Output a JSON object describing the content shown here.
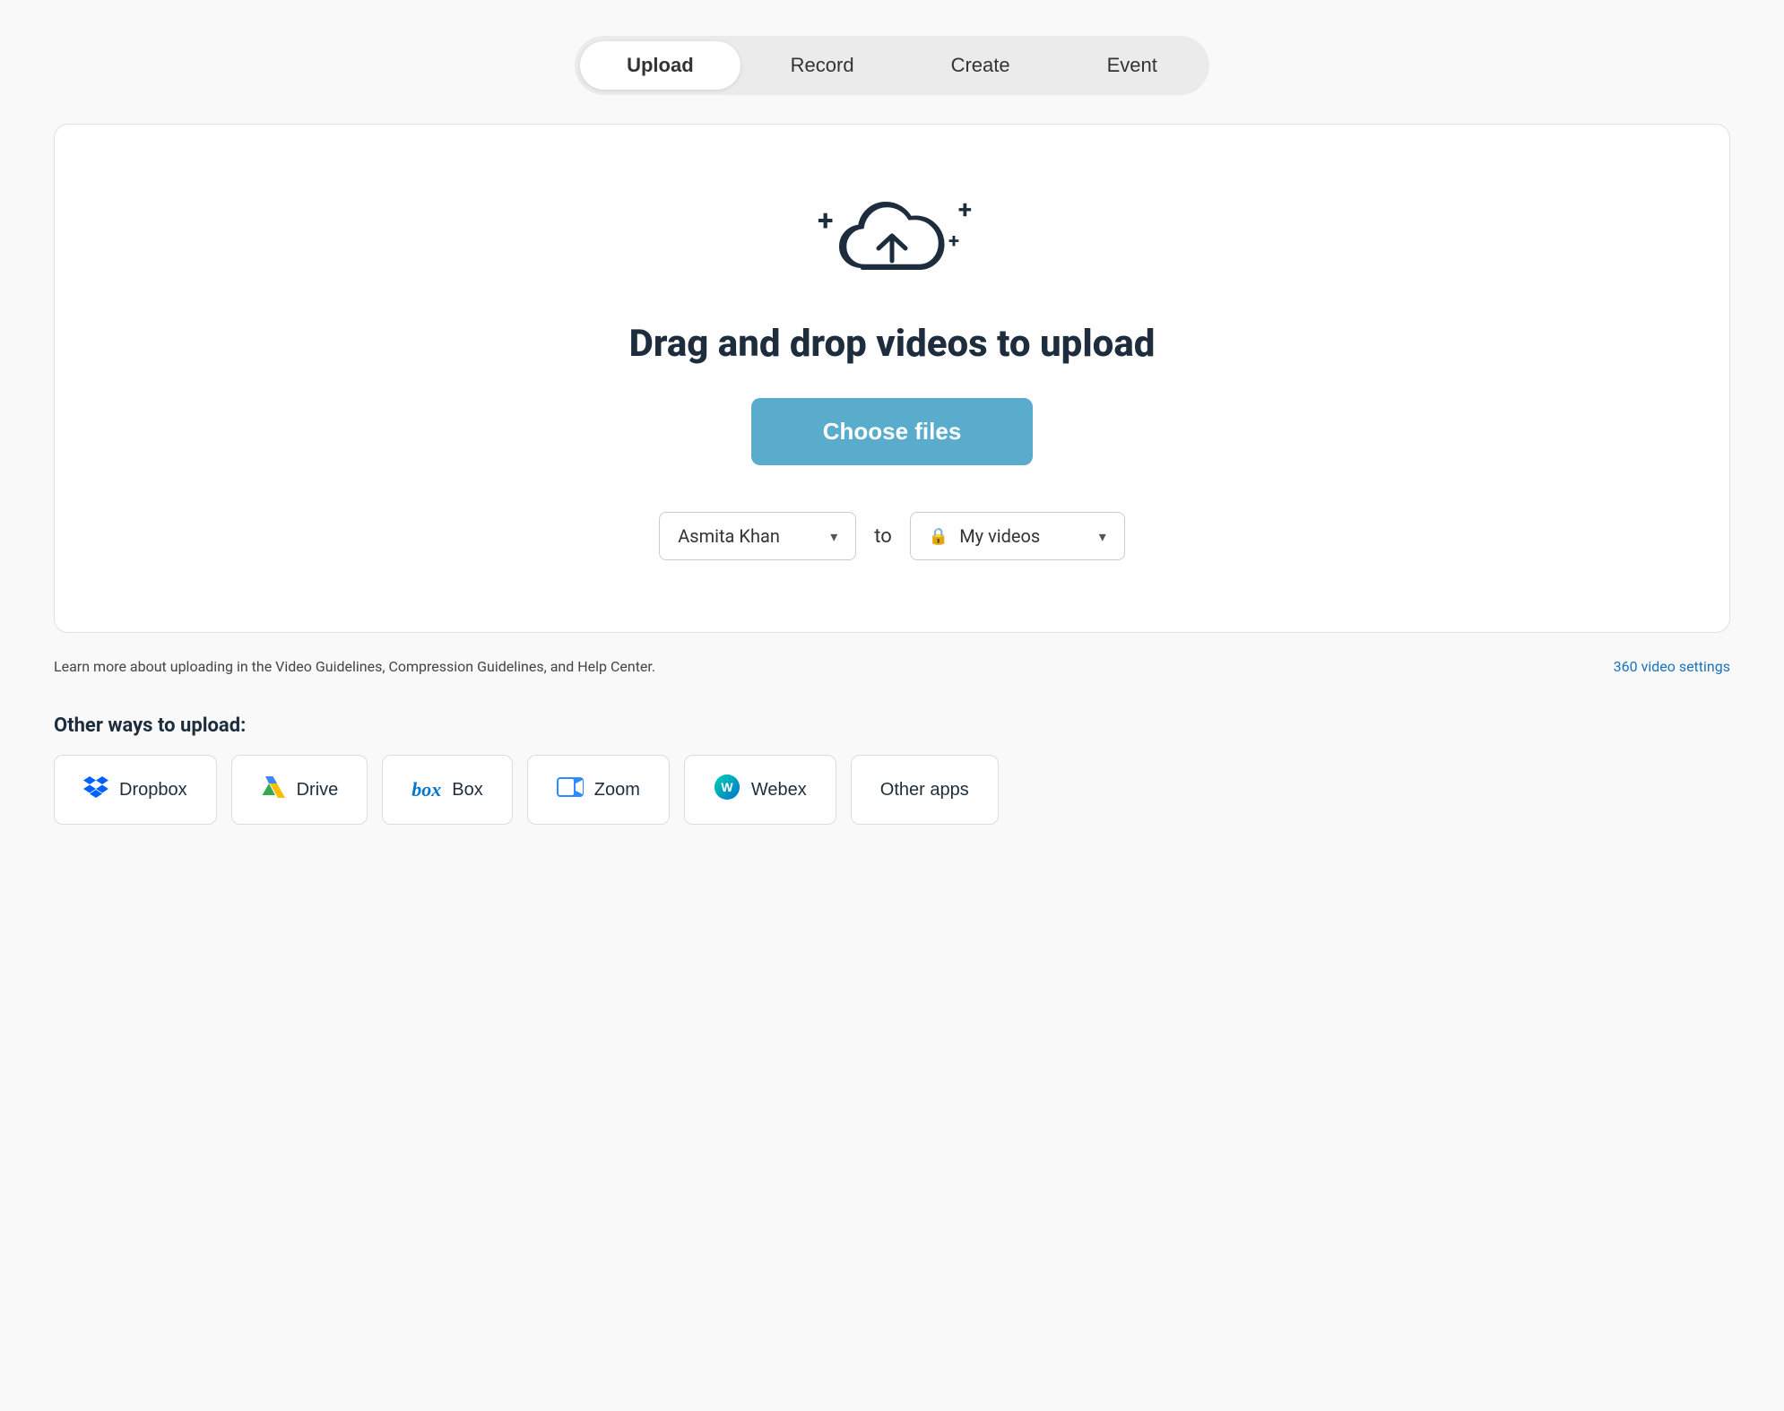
{
  "tabs": {
    "items": [
      {
        "label": "Upload",
        "active": true
      },
      {
        "label": "Record",
        "active": false
      },
      {
        "label": "Create",
        "active": false
      },
      {
        "label": "Event",
        "active": false
      }
    ]
  },
  "upload_area": {
    "drag_title": "Drag and drop videos to upload",
    "choose_files_label": "Choose files",
    "to_label": "to",
    "user_dropdown": {
      "value": "Asmita Khan",
      "placeholder": "Asmita Khan"
    },
    "destination_dropdown": {
      "value": "My videos",
      "placeholder": "My videos"
    }
  },
  "info_bar": {
    "text": "Learn more about uploading in the Video Guidelines, Compression Guidelines, and Help Center.",
    "link_label": "360 video settings"
  },
  "other_ways": {
    "label": "Other ways to upload:",
    "items": [
      {
        "id": "dropbox",
        "label": "Dropbox"
      },
      {
        "id": "drive",
        "label": "Drive"
      },
      {
        "id": "box",
        "label": "Box"
      },
      {
        "id": "zoom",
        "label": "Zoom"
      },
      {
        "id": "webex",
        "label": "Webex"
      },
      {
        "id": "other-apps",
        "label": "Other apps"
      }
    ]
  },
  "icons": {
    "plus": "+",
    "chevron_down": "▾",
    "lock": "🔒"
  }
}
